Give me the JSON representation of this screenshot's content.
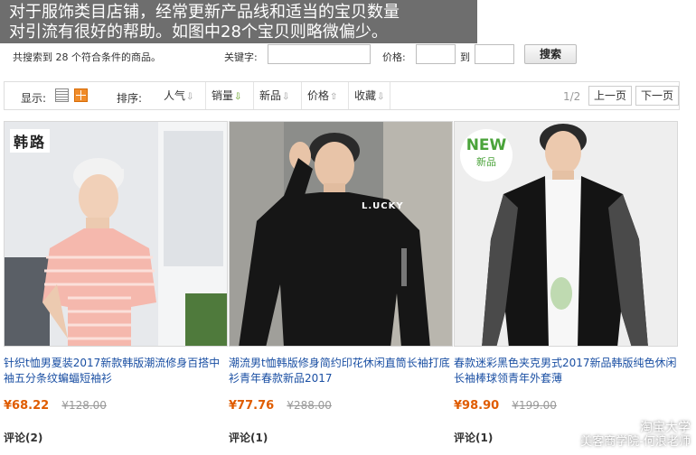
{
  "overlay": {
    "line1": "对于服饰类目店铺，经常更新产品线和适当的宝贝数量",
    "line2": "对引流有很好的帮助。如图中28个宝贝则略微偏少。"
  },
  "search": {
    "result_text": "共搜索到 28 个符合条件的商品。",
    "keyword_label": "关键字:",
    "keyword_value": "",
    "price_label": "价格:",
    "price_to_label": "到",
    "price_min_value": "",
    "price_max_value": "",
    "search_button": "搜索"
  },
  "toolbar": {
    "display_label": "显示:",
    "sort_label": "排序:",
    "sort_options": [
      {
        "label": "人气"
      },
      {
        "label": "销量"
      },
      {
        "label": "新品"
      },
      {
        "label": "价格"
      },
      {
        "label": "收藏"
      }
    ],
    "page_info": "1/2",
    "prev_page": "上一页",
    "next_page": "下一页"
  },
  "products": [
    {
      "title": "针织t恤男夏装2017新款韩版潮流修身百搭中袖五分条纹蝙蝠短袖衫",
      "price": "¥68.22",
      "original_price": "¥128.00",
      "comments": "评论(2)",
      "badge": "韩路"
    },
    {
      "title": "潮流男t恤韩版修身简约印花休闲直筒长袖打底衫青年春款新品2017",
      "price": "¥77.76",
      "original_price": "¥288.00",
      "comments": "评论(1)",
      "shirt_print": "L.UCKY"
    },
    {
      "title": "春款迷彩黑色夹克男式2017新品韩版纯色休闲长袖棒球领青年外套薄",
      "price": "¥98.90",
      "original_price": "¥199.00",
      "comments": "评论(1)",
      "badge_top": "NEW",
      "badge_bottom": "新品"
    }
  ],
  "watermark": {
    "line1": "淘宝大学",
    "line2": "美客商学院-何浪老师"
  },
  "colors": {
    "link_blue": "#1a4fa3",
    "price_orange": "#e05c00",
    "sort_active_green": "#5a9a16",
    "grid_icon_orange": "#f08c2a"
  }
}
